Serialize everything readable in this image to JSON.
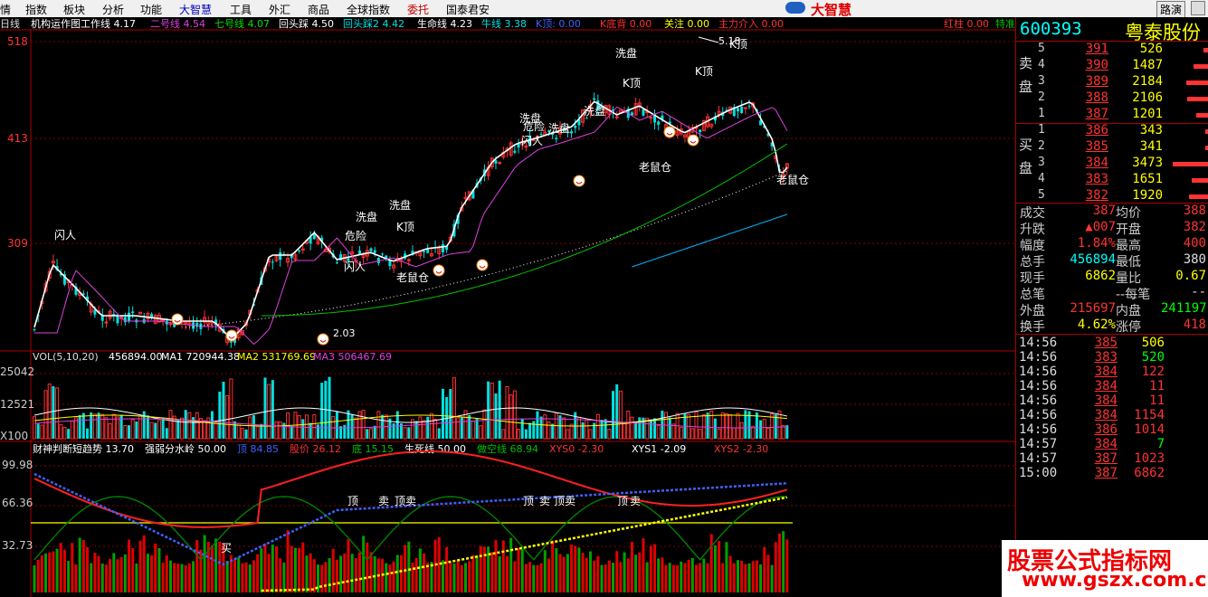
{
  "menu": {
    "items": [
      "情",
      "指数",
      "板块",
      "分析",
      "功能",
      "大智慧",
      "工具",
      "外汇",
      "商品",
      "全球指数",
      "委托",
      "国泰君安"
    ],
    "brand": "大智慧",
    "route_btn": "路演"
  },
  "header": {
    "period": "日线",
    "title": "机构运作图工作线",
    "title_val": "4.17",
    "inds": [
      {
        "label": "二号线",
        "val": "4.54",
        "color": "#e040e0"
      },
      {
        "label": "七号线",
        "val": "4.07",
        "color": "#00e000"
      },
      {
        "label": "回头踩",
        "val": "4.50",
        "color": "#ffffff"
      },
      {
        "label": "回头踩2",
        "val": "4.42",
        "color": "#00e0e0"
      },
      {
        "label": "生命线",
        "val": "4.23",
        "color": "#ffffff"
      },
      {
        "label": "牛线",
        "val": "3.38",
        "color": "#00e0e0"
      },
      {
        "label": "K顶:",
        "val": "0.00",
        "color": "#4060ff"
      },
      {
        "label": "K底背",
        "val": "0.00",
        "color": "#ff3030"
      },
      {
        "label": "关注",
        "val": "0.00",
        "color": "#ffff00"
      },
      {
        "label": "主力介入",
        "val": "0.00",
        "color": "#ff3030"
      }
    ],
    "right_labels": [
      {
        "label": "红柱",
        "val": "0.00",
        "color": "#ff3030"
      },
      {
        "label": "特准",
        "val": "",
        "color": "#00c000"
      }
    ]
  },
  "axis": {
    "main_ticks": [
      "518",
      "413",
      "309"
    ],
    "vol_ticks": [
      "25042",
      "12521",
      "X100"
    ],
    "ind_ticks": [
      "99.98",
      "66.36",
      "32.73"
    ]
  },
  "price_annotations": {
    "high_label": "5.18",
    "low_label": "2.03",
    "signals": [
      "闪人",
      "洗盘",
      "危险",
      "闪人",
      "洗盘",
      "K顶",
      "老鼠仓",
      "洗盘",
      "危险",
      "闪人",
      "洗盘",
      "洗盘",
      "洗盘",
      "K顶",
      "老鼠仓",
      "K顶",
      "K顶",
      "老鼠仓"
    ]
  },
  "vol_header": {
    "title": "VOL(5,10,20)",
    "vol": "456894.00",
    "ma1_label": "MA1",
    "ma1": "720944.38",
    "ma2_label": "MA2",
    "ma2": "531769.69",
    "ma3_label": "MA3",
    "ma3": "506467.69"
  },
  "ind_header": [
    {
      "label": "财神判断短趋势",
      "val": "13.70",
      "color": "#ffffff"
    },
    {
      "label": "强弱分水岭",
      "val": "50.00",
      "color": "#ffffff"
    },
    {
      "label": "顶",
      "val": "84.85",
      "color": "#4060ff"
    },
    {
      "label": "股价",
      "val": "26.12",
      "color": "#ff3030"
    },
    {
      "label": "底",
      "val": "15.15",
      "color": "#00c000"
    },
    {
      "label": "生死线",
      "val": "50.00",
      "color": "#ffffff"
    },
    {
      "label": "做空线",
      "val": "68.94",
      "color": "#00c000"
    },
    {
      "label": "XYS0",
      "val": "-2.30",
      "color": "#ff3030"
    },
    {
      "label": "XYS1",
      "val": "-2.09",
      "color": "#ffffff"
    },
    {
      "label": "XYS2",
      "val": "-2.30",
      "color": "#ff3030"
    }
  ],
  "ind_signals": [
    "买",
    "顶",
    "卖",
    "顶卖",
    "顶",
    "卖",
    "顶卖",
    "顶",
    "卖"
  ],
  "stock": {
    "code": "600393",
    "name": "粤泰股份"
  },
  "orderbook": {
    "sell_label": "卖盘",
    "buy_label": "买盘",
    "asks": [
      {
        "lvl": "5",
        "price": "391",
        "vol": "526"
      },
      {
        "lvl": "4",
        "price": "390",
        "vol": "1487"
      },
      {
        "lvl": "3",
        "price": "389",
        "vol": "2184"
      },
      {
        "lvl": "2",
        "price": "388",
        "vol": "2106"
      },
      {
        "lvl": "1",
        "price": "387",
        "vol": "1201"
      }
    ],
    "bids": [
      {
        "lvl": "1",
        "price": "386",
        "vol": "343"
      },
      {
        "lvl": "2",
        "price": "385",
        "vol": "341"
      },
      {
        "lvl": "3",
        "price": "384",
        "vol": "3473"
      },
      {
        "lvl": "4",
        "price": "383",
        "vol": "1651"
      },
      {
        "lvl": "5",
        "price": "382",
        "vol": "1920"
      }
    ]
  },
  "stats": [
    {
      "k": "成交",
      "v": "387",
      "vc": "#f33",
      "k2": "均价",
      "v2": "388",
      "v2c": "#f33"
    },
    {
      "k": "升跌",
      "v": "▲007",
      "vc": "#f33",
      "k2": "开盘",
      "v2": "382",
      "v2c": "#f33"
    },
    {
      "k": "幅度",
      "v": "1.84%",
      "vc": "#f33",
      "k2": "最高",
      "v2": "400",
      "v2c": "#f33"
    },
    {
      "k": "总手",
      "v": "456894",
      "vc": "#0ff",
      "k2": "最低",
      "v2": "380",
      "v2c": "#ddd"
    },
    {
      "k": "现手",
      "v": "6862",
      "vc": "#ff0",
      "k2": "量比",
      "v2": "0.67",
      "v2c": "#ff0"
    },
    {
      "k": "总笔",
      "v": "",
      "vc": "#ddd",
      "k2": "--每笔",
      "v2": "--",
      "v2c": "#ddd"
    },
    {
      "k": "外盘",
      "v": "215697",
      "vc": "#f33",
      "k2": "内盘",
      "v2": "241197",
      "v2c": "#0f0"
    },
    {
      "k": "换手",
      "v": "4.62%",
      "vc": "#ff0",
      "k2": "涨停",
      "v2": "418",
      "v2c": "#f33"
    }
  ],
  "ticks": [
    {
      "t": "14:56",
      "p": "385",
      "q": "506",
      "qc": "#ff0"
    },
    {
      "t": "14:56",
      "p": "383",
      "q": "520",
      "qc": "#0f0"
    },
    {
      "t": "14:56",
      "p": "384",
      "q": "122",
      "qc": "#f33"
    },
    {
      "t": "14:56",
      "p": "384",
      "q": "11",
      "qc": "#f33"
    },
    {
      "t": "14:56",
      "p": "384",
      "q": "11",
      "qc": "#f33"
    },
    {
      "t": "14:56",
      "p": "384",
      "q": "1154",
      "qc": "#f33"
    },
    {
      "t": "14:56",
      "p": "386",
      "q": "1014",
      "qc": "#f33"
    },
    {
      "t": "14:57",
      "p": "384",
      "q": "7",
      "qc": "#0f0"
    },
    {
      "t": "14:57",
      "p": "387",
      "q": "1023",
      "qc": "#f33"
    },
    {
      "t": "15:00",
      "p": "387",
      "q": "6862",
      "qc": "#f33"
    }
  ],
  "watermark": {
    "line1": "股票公式指标网",
    "line2": "www.gszx.com.cn"
  }
}
